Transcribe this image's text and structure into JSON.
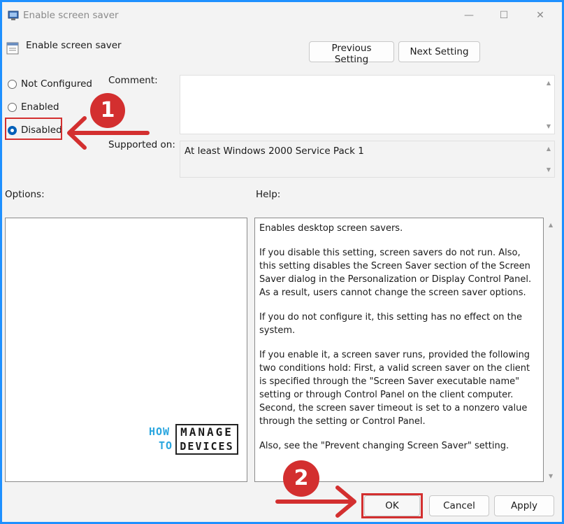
{
  "window": {
    "title": "Enable screen saver",
    "setting_name": "Enable screen saver",
    "controls": {
      "minimize": "—",
      "maximize": "☐",
      "close": "✕"
    }
  },
  "nav": {
    "previous_label": "Previous Setting",
    "next_label": "Next Setting"
  },
  "state": {
    "options": [
      {
        "label": "Not Configured",
        "checked": false
      },
      {
        "label": "Enabled",
        "checked": false
      },
      {
        "label": "Disabled",
        "checked": true
      }
    ]
  },
  "fields": {
    "comment_label": "Comment:",
    "comment_value": "",
    "supported_label": "Supported on:",
    "supported_value": "At least Windows 2000 Service Pack 1"
  },
  "sections": {
    "options_label": "Options:",
    "help_label": "Help:"
  },
  "help": {
    "paragraphs": [
      "Enables desktop screen savers.",
      "If you disable this setting, screen savers do not run. Also, this setting disables the Screen Saver section of the Screen Saver dialog in the Personalization or Display Control Panel. As a result, users cannot change the screen saver options.",
      "If you do not configure it, this setting has no effect on the system.",
      "If you enable it, a screen saver runs, provided the following two conditions hold: First, a valid screen saver on the client is specified through the \"Screen Saver executable name\" setting or through Control Panel on the client computer. Second, the screen saver timeout is set to a nonzero value through the setting or Control Panel.",
      "Also, see the \"Prevent changing Screen Saver\" setting."
    ]
  },
  "footer": {
    "ok_label": "OK",
    "cancel_label": "Cancel",
    "apply_label": "Apply"
  },
  "annotations": {
    "step1": "1",
    "step2": "2",
    "accent_color": "#d32f2f"
  },
  "watermark": {
    "how": "HOW",
    "to": "TO",
    "manage": "MANAGE",
    "devices": "DEVICES"
  },
  "colors": {
    "background_border": "#1e90ff",
    "selected_radio": "#005fb8"
  }
}
